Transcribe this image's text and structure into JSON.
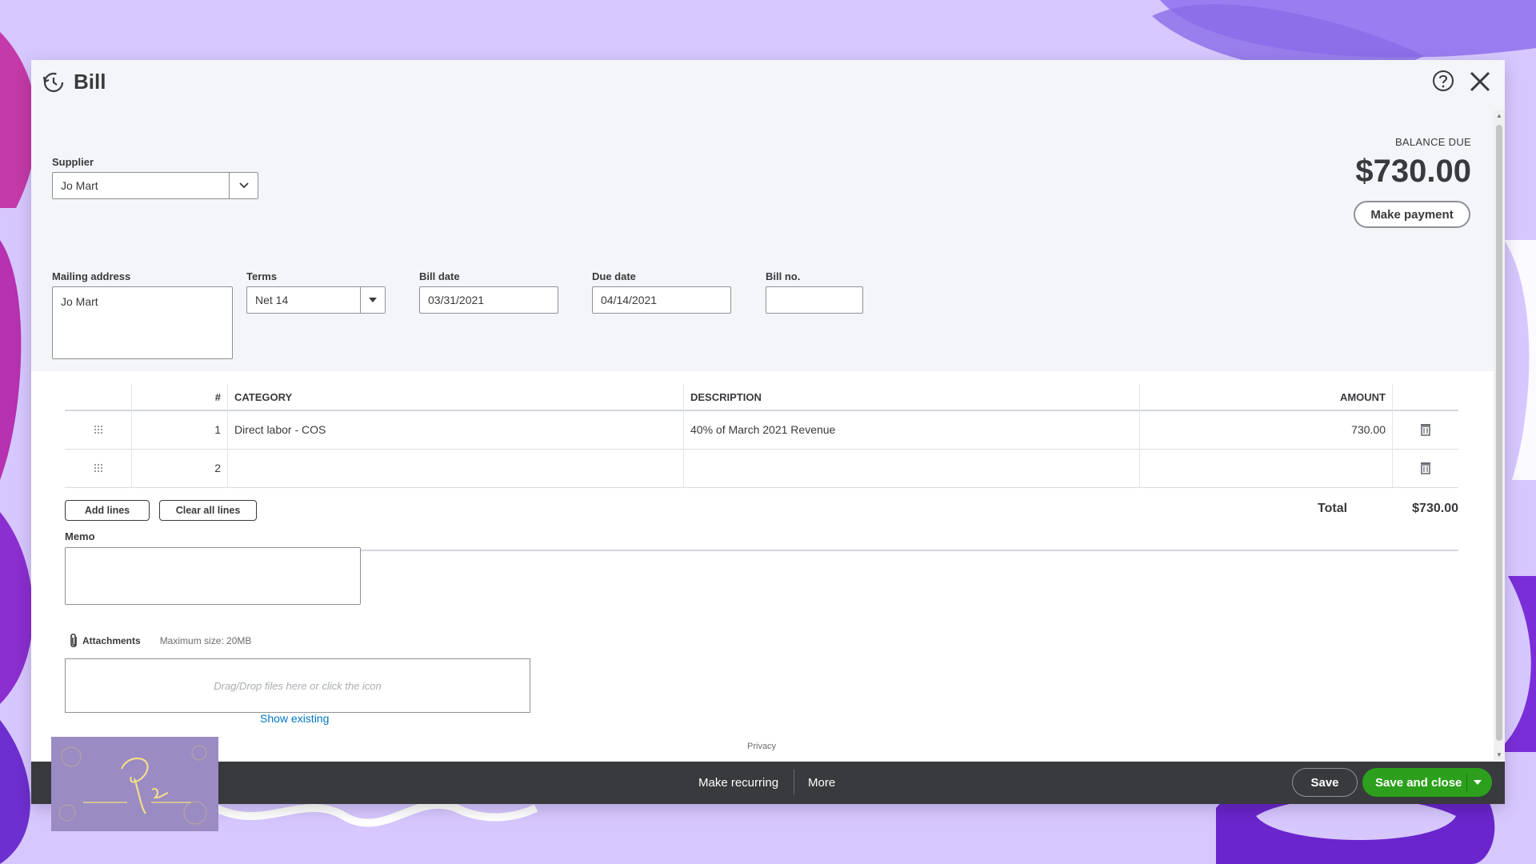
{
  "window": {
    "title": "Bill"
  },
  "supplier": {
    "label": "Supplier",
    "value": "Jo Mart"
  },
  "balance": {
    "label": "BALANCE DUE",
    "amount": "$730.00",
    "make_payment_label": "Make payment"
  },
  "mailing_address": {
    "label": "Mailing address",
    "value": "Jo Mart"
  },
  "terms": {
    "label": "Terms",
    "value": "Net 14"
  },
  "bill_date": {
    "label": "Bill date",
    "value": "03/31/2021"
  },
  "due_date": {
    "label": "Due date",
    "value": "04/14/2021"
  },
  "bill_no": {
    "label": "Bill no.",
    "value": ""
  },
  "table": {
    "headers": {
      "num": "#",
      "category": "CATEGORY",
      "description": "DESCRIPTION",
      "amount": "AMOUNT"
    },
    "rows": [
      {
        "num": "1",
        "category": "Direct labor - COS",
        "description": "40% of March 2021 Revenue",
        "amount": "730.00"
      },
      {
        "num": "2",
        "category": "",
        "description": "",
        "amount": ""
      }
    ]
  },
  "actions": {
    "add_lines": "Add lines",
    "clear_all_lines": "Clear all lines"
  },
  "totals": {
    "label": "Total",
    "amount": "$730.00"
  },
  "memo": {
    "label": "Memo",
    "value": ""
  },
  "attachments": {
    "label": "Attachments",
    "max_size": "Maximum size: 20MB",
    "dropzone_text": "Drag/Drop files here or click the icon",
    "show_existing": "Show existing"
  },
  "privacy": "Privacy",
  "footer": {
    "make_recurring": "Make recurring",
    "more": "More",
    "save": "Save",
    "save_and_close": "Save and close"
  },
  "colors": {
    "primary_green": "#2ca01c",
    "footer_dark": "#393a3d",
    "link_blue": "#0077c5",
    "background_purple": "#d7c7ff"
  }
}
